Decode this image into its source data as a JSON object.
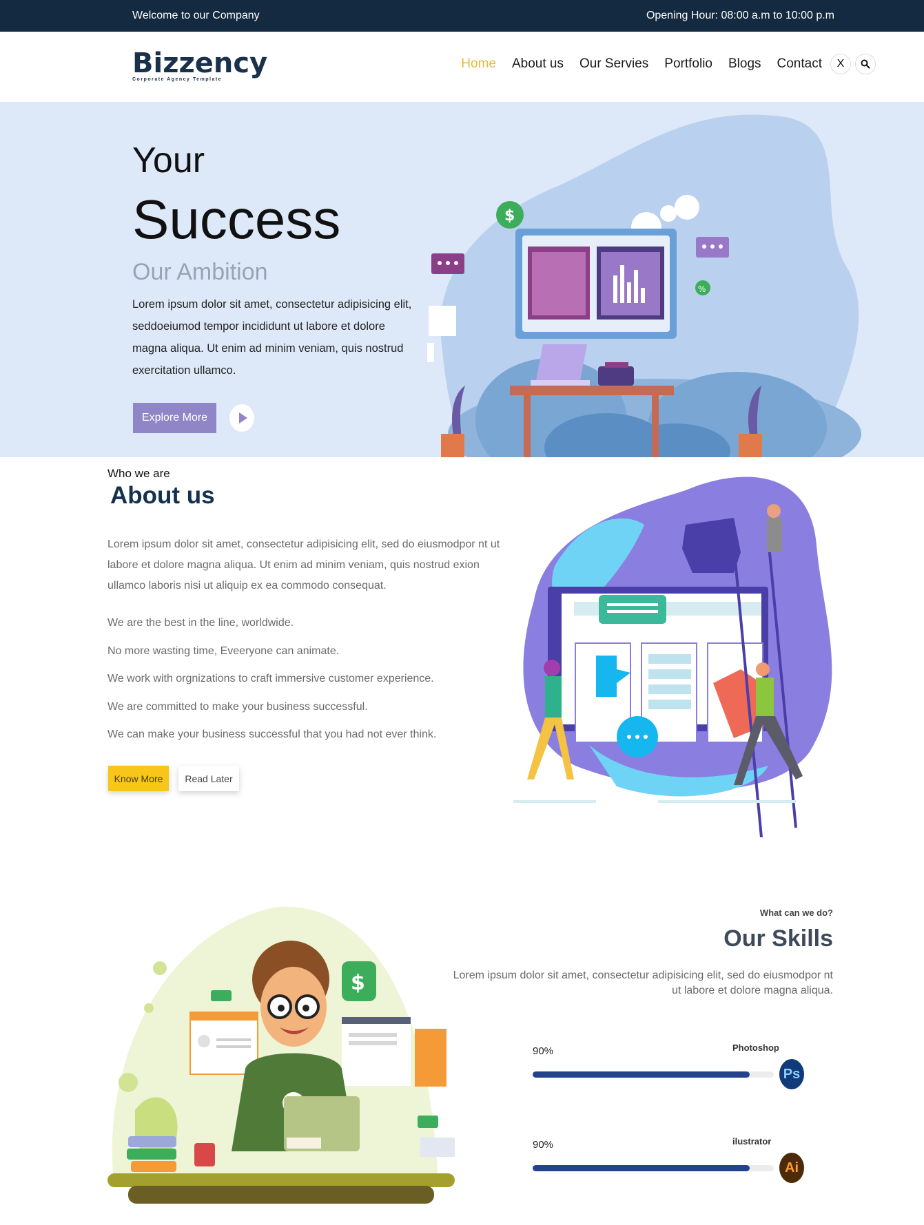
{
  "topbar": {
    "welcome": "Welcome to our Company",
    "hours": "Opening Hour: 08:00 a.m to 10:00 p.m"
  },
  "logo": {
    "name": "Bizzency",
    "tagline": "Corporate Agency Template"
  },
  "nav": {
    "items": [
      "Home",
      "About us",
      "Our Servies",
      "Portfolio",
      "Blogs",
      "Contact"
    ],
    "active": "Home",
    "close_label": "X",
    "search_icon": "search-icon"
  },
  "hero": {
    "line1": "Your",
    "line2": "Success",
    "subtitle": "Our Ambition",
    "description": "Lorem ipsum dolor sit amet, consectetur adipisicing elit, seddoeiumod tempor incididunt ut labore et dolore magna aliqua. Ut enim ad minim veniam, quis nostrud exercitation ullamco.",
    "explore_label": "Explore More",
    "play_icon": "play-icon",
    "illustration_dollar": "$",
    "illustration_percent": "%"
  },
  "about": {
    "eyebrow": "Who we are",
    "title": "About us",
    "description": "Lorem ipsum dolor sit amet, consectetur adipisicing elit, sed do eiusmodpor nt ut labore et dolore magna aliqua. Ut enim ad minim veniam, quis nostrud exion ullamco laboris nisi ut aliquip ex ea commodo consequat.",
    "points": [
      "We are the best in the line, worldwide.",
      "No more wasting time, Eveeryone can animate.",
      "We work with orgnizations to craft immersive customer experience.",
      "We are committed to make your business successful.",
      "We can make your business successful that you had not ever think."
    ],
    "know_more_label": "Know More",
    "read_later_label": "Read Later"
  },
  "skills": {
    "eyebrow": "What can we do?",
    "title": "Our Skills",
    "description": "Lorem ipsum dolor sit amet, consectetur adipisicing elit, sed do eiusmodpor nt ut labore et dolore magna aliqua.",
    "illustration_dollar": "$",
    "items": [
      {
        "name": "Photoshop",
        "percent_label": "90%",
        "level": 0.9,
        "badge": "Ps"
      },
      {
        "name": "ilustrator",
        "percent_label": "90%",
        "level": 0.9,
        "badge": "Ai"
      }
    ]
  },
  "colors": {
    "topbar": "#142a40",
    "accent_nav": "#e6b93a",
    "hero_bg": "#dde9f8",
    "explore_button": "#8f85c7",
    "know_more_button": "#f7c619",
    "progress_fill": "#24438e"
  }
}
